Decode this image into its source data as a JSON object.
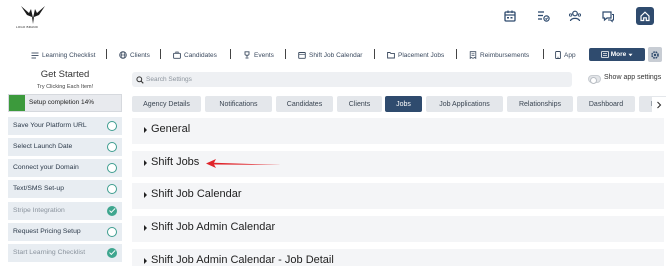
{
  "header": {
    "logo_icon": "eagle-logo-icon",
    "logo_text": "LOGO BRAND",
    "icons": [
      "calendar-icon",
      "tasks-icon",
      "users-icon",
      "chat-icon",
      "home-icon"
    ],
    "accent_color": "#2f4b6e"
  },
  "nav": {
    "items": [
      {
        "label": "Learning Checklist",
        "icon": "checklist-icon"
      },
      {
        "label": "Clients",
        "icon": "globe-icon"
      },
      {
        "label": "Candidates",
        "icon": "briefcase-icon"
      },
      {
        "label": "Events",
        "icon": "trophy-icon"
      },
      {
        "label": "Shift Job Calendar",
        "icon": "calendar-icon"
      },
      {
        "label": "Placement Jobs",
        "icon": "folder-icon"
      },
      {
        "label": "Reimbursements",
        "icon": "receipt-icon"
      },
      {
        "label": "App",
        "icon": "phone-icon"
      }
    ],
    "more_label": "More",
    "settings_icon": "gear-icon"
  },
  "sidebar": {
    "title": "Get Started",
    "subtitle": "Try Clicking Each Item!",
    "progress_label": "Setup completion 14%",
    "progress_fraction": 0.14,
    "progress_color": "#3c9a3c",
    "tasks": [
      {
        "label": "Save Your Platform URL",
        "done": false
      },
      {
        "label": "Select Launch Date",
        "done": false
      },
      {
        "label": "Connect your Domain",
        "done": false
      },
      {
        "label": "Text/SMS Set-up",
        "done": false
      },
      {
        "label": "Stripe Integration",
        "done": true
      },
      {
        "label": "Request Pricing Setup",
        "done": false
      },
      {
        "label": "Start Learning Checklist",
        "done": true
      }
    ]
  },
  "main": {
    "search_placeholder": "Search Settings",
    "toggle_label": "Show app settings",
    "tabs": [
      {
        "label": "Agency Details",
        "active": false
      },
      {
        "label": "Notifications",
        "active": false
      },
      {
        "label": "Candidates",
        "active": false
      },
      {
        "label": "Clients",
        "active": false
      },
      {
        "label": "Jobs",
        "active": true
      },
      {
        "label": "Job Applications",
        "active": false
      },
      {
        "label": "Relationships",
        "active": false
      },
      {
        "label": "Dashboard",
        "active": false
      },
      {
        "label": "E",
        "active": false
      }
    ],
    "tab_scroll_icon": "chevron-right-icon",
    "sections": [
      {
        "label": "General"
      },
      {
        "label": "Shift Jobs"
      },
      {
        "label": "Shift Job Calendar"
      },
      {
        "label": "Shift Job Admin Calendar"
      },
      {
        "label": "Shift Job Admin Calendar - Job Detail"
      }
    ],
    "annotation_color": "#e0242a"
  }
}
